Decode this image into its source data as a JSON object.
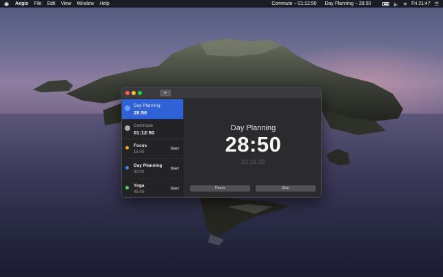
{
  "menubar": {
    "app_name": "Aegis",
    "menus": [
      "File",
      "Edit",
      "View",
      "Window",
      "Help"
    ],
    "status_timers": [
      "Commute – 01:12:50",
      "Day Planning – 28:50"
    ],
    "clock": "Fri 21:47"
  },
  "window": {
    "sidebar": {
      "items": [
        {
          "name": "Day Planning",
          "time": "28:50",
          "color": "#6e9cf5",
          "state": "running",
          "selected": true
        },
        {
          "name": "Commute",
          "time": "01:12:50",
          "color": "#a9a9ad",
          "state": "running",
          "selected": false
        },
        {
          "name": "Focus",
          "time": "15:00",
          "color": "#f0a030",
          "state": "idle",
          "action": "Start"
        },
        {
          "name": "Day Planning",
          "time": "30:00",
          "color": "#3f82f0",
          "state": "idle",
          "action": "Start"
        },
        {
          "name": "Yoga",
          "time": "45:00",
          "color": "#58d068",
          "state": "idle",
          "action": "Start"
        }
      ]
    },
    "detail": {
      "title": "Day Planning",
      "countdown": "28:50",
      "end_time": "22:16:25",
      "pause_label": "Pause",
      "stop_label": "Stop"
    }
  },
  "colors": {
    "selection": "#2f62d6",
    "window_bg": "#2b2b2d",
    "sidebar_bg": "#232325"
  }
}
